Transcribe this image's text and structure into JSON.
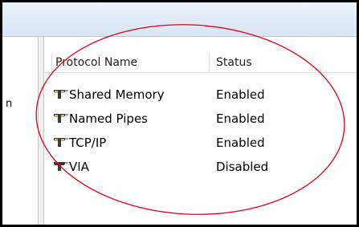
{
  "left_pane": {
    "clipped_text": "n"
  },
  "table": {
    "headers": {
      "name": "Protocol Name",
      "status": "Status"
    },
    "rows": [
      {
        "name": "Shared Memory",
        "status": "Enabled",
        "icon": "protocol-icon"
      },
      {
        "name": "Named Pipes",
        "status": "Enabled",
        "icon": "protocol-icon"
      },
      {
        "name": "TCP/IP",
        "status": "Enabled",
        "icon": "protocol-icon"
      },
      {
        "name": "VIA",
        "status": "Disabled",
        "icon": "protocol-icon"
      }
    ]
  },
  "colors": {
    "annotation_ellipse": "#e0001b",
    "frame_border": "#000000",
    "header_gradient_top": "#edf3fa",
    "header_gradient_bottom": "#d8e5f3"
  }
}
